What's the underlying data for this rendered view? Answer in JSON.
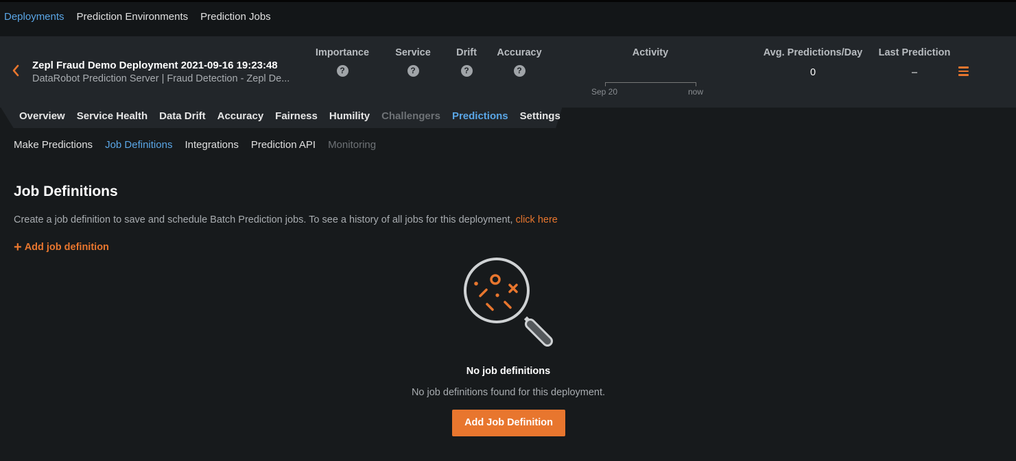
{
  "topnav": {
    "items": [
      "Deployments",
      "Prediction Environments",
      "Prediction Jobs"
    ],
    "active": "Deployments"
  },
  "header": {
    "title": "Zepl Fraud Demo Deployment 2021-09-16 19:23:48",
    "subtitle": "DataRobot Prediction Server | Fraud Detection - Zepl De...",
    "metrics": {
      "importance": "Importance",
      "service": "Service",
      "drift": "Drift",
      "accuracy": "Accuracy",
      "activity": "Activity",
      "avg_predictions": "Avg. Predictions/Day",
      "last_prediction": "Last Prediction"
    },
    "activity_start": "Sep 20",
    "activity_end": "now",
    "avg_predictions_value": "0",
    "last_prediction_value": "–",
    "help_glyph": "?"
  },
  "tabs": {
    "items": [
      "Overview",
      "Service Health",
      "Data Drift",
      "Accuracy",
      "Fairness",
      "Humility",
      "Challengers",
      "Predictions",
      "Settings"
    ],
    "active": "Predictions",
    "disabled": [
      "Challengers"
    ]
  },
  "subtabs": {
    "items": [
      "Make Predictions",
      "Job Definitions",
      "Integrations",
      "Prediction API",
      "Monitoring"
    ],
    "active": "Job Definitions",
    "disabled": [
      "Monitoring"
    ]
  },
  "main": {
    "title": "Job Definitions",
    "description": "Create a job definition to save and schedule Batch Prediction jobs. To see a history of all jobs for this deployment, ",
    "description_link": "click here",
    "add_link": "Add job definition",
    "empty_title": "No job definitions",
    "empty_sub": "No job definitions found for this deployment.",
    "button": "Add Job Definition"
  },
  "colors": {
    "accent_orange": "#e8762e",
    "active_blue": "#5aa6e6",
    "background": "#171a1c",
    "header_bg": "#22262a"
  },
  "icons": {
    "back": "chevron-left-icon",
    "help": "question-circle-icon",
    "menu": "hamburger-menu-icon",
    "illustration": "magnifier-icon"
  }
}
